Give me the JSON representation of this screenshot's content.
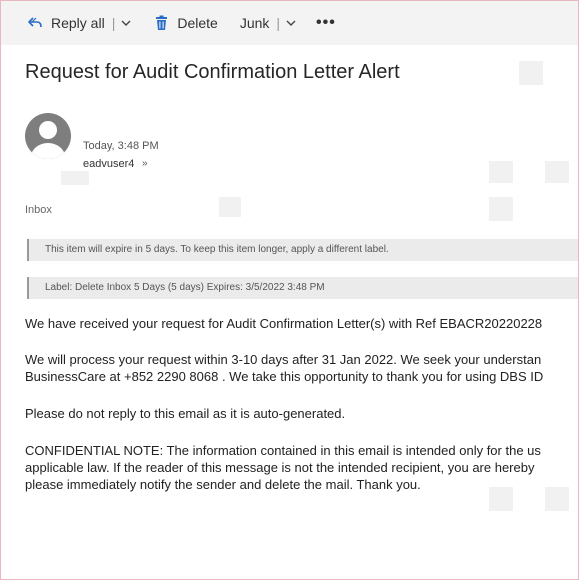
{
  "toolbar": {
    "reply_all_label": "Reply all",
    "delete_label": "Delete",
    "junk_label": "Junk",
    "separator": "|",
    "more_label": "•••",
    "reply_icon": "reply-all-arrow",
    "delete_icon": "trash-can",
    "dropdown_icon": "chevron-down"
  },
  "message": {
    "subject": "Request for Audit Confirmation Letter Alert",
    "date": "Today, 3:48 PM",
    "sender": "eadvuser4",
    "sender_expand": "»",
    "folder": "Inbox",
    "expire_notice": "This item will expire in 5 days. To keep this item longer, apply a different label.",
    "label_notice": "Label: Delete Inbox 5 Days (5 days) Expires: 3/5/2022 3:48 PM",
    "body": {
      "p1": "We have received your request for Audit Confirmation Letter(s) with Ref EBACR20220228",
      "p2_line1": "We will process your request within 3-10 days after 31 Jan 2022. We seek your understan",
      "p2_line2": "BusinessCare at +852 2290 8068 . We take this opportunity to thank you for using DBS ID",
      "p3": "Please do not reply to this email as it is auto-generated.",
      "p4_line1": "CONFIDENTIAL NOTE: The information contained in this email is intended only for the us",
      "p4_line2": "applicable law. If the reader of this message is not the intended recipient, you are hereby",
      "p4_line3": "please immediately notify the sender and delete the mail. Thank you."
    }
  },
  "colors": {
    "toolbar_bg": "#f3f3f3",
    "accent_blue": "#2b6cc4",
    "infobar_bg": "#ebebeb",
    "frame_border": "#e8b7bf"
  }
}
